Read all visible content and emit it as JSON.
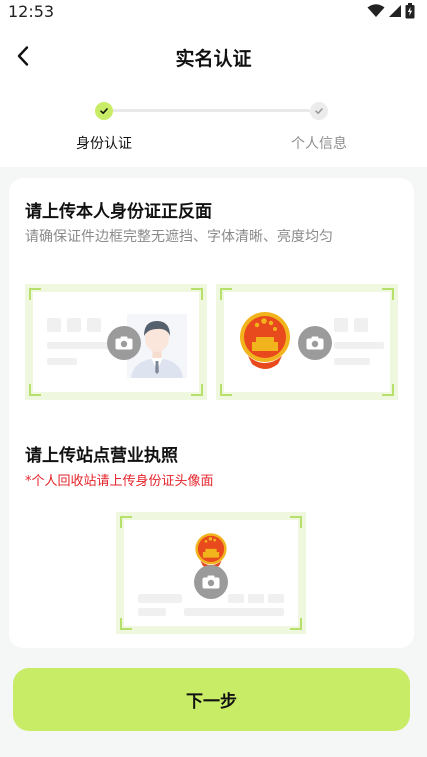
{
  "status_bar": {
    "time": "12:53"
  },
  "header": {
    "title": "实名认证"
  },
  "steps": [
    {
      "label": "身份认证",
      "state": "active"
    },
    {
      "label": "个人信息",
      "state": "inactive"
    }
  ],
  "id_section": {
    "title": "请上传本人身份证正反面",
    "subtitle": "请确保证件边框完整无遮挡、字体清晰、亮度均匀"
  },
  "license_section": {
    "title": "请上传站点营业执照",
    "warning": "*个人回收站请上传身份证头像面"
  },
  "next_button": {
    "label": "下一步"
  },
  "colors": {
    "accent": "#c9ec66",
    "frame": "#eff8df",
    "warning": "#e5232b",
    "emblem": "#e8491d"
  }
}
